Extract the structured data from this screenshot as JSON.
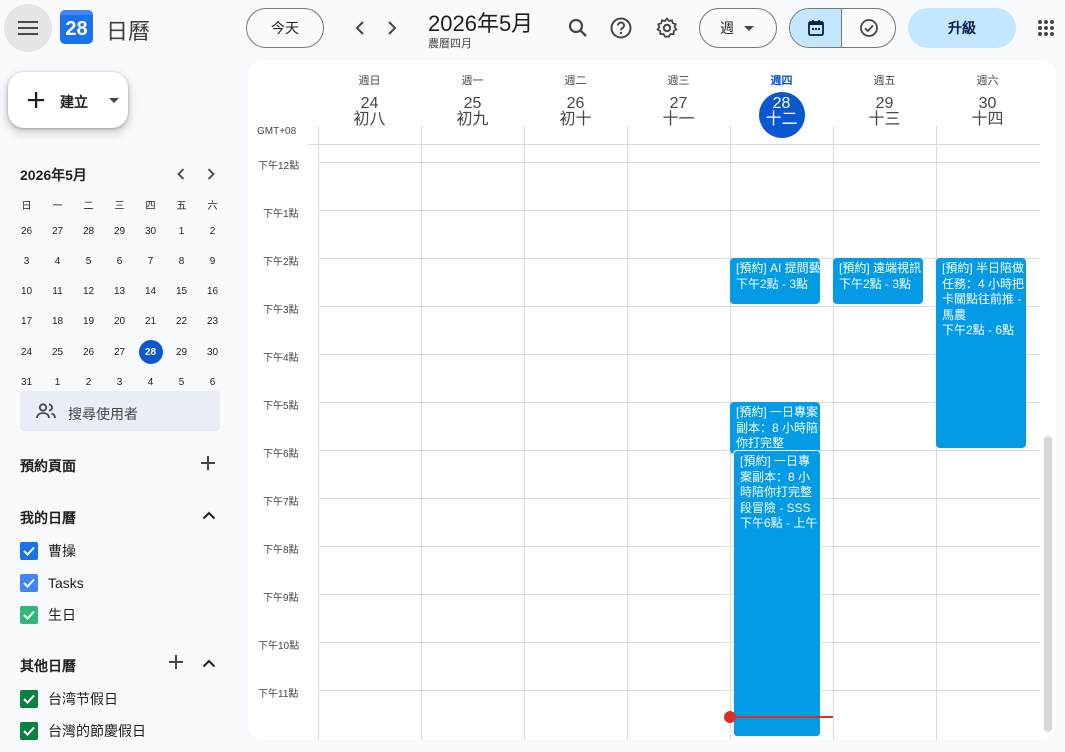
{
  "header": {
    "app_title": "日曆",
    "logo_day": "28",
    "today_label": "今天",
    "month_title": "2026年5月",
    "lunar_month": "農曆四月",
    "view_label": "週",
    "upgrade_label": "升級"
  },
  "sidebar": {
    "create_label": "建立",
    "mini_calendar": {
      "title": "2026年5月",
      "weekdays": [
        "日",
        "一",
        "二",
        "三",
        "四",
        "五",
        "六"
      ],
      "weeks": [
        [
          "26",
          "27",
          "28",
          "29",
          "30",
          "1",
          "2"
        ],
        [
          "3",
          "4",
          "5",
          "6",
          "7",
          "8",
          "9"
        ],
        [
          "10",
          "11",
          "12",
          "13",
          "14",
          "15",
          "16"
        ],
        [
          "17",
          "18",
          "19",
          "20",
          "21",
          "22",
          "23"
        ],
        [
          "24",
          "25",
          "26",
          "27",
          "28",
          "29",
          "30"
        ],
        [
          "31",
          "1",
          "2",
          "3",
          "4",
          "5",
          "6"
        ]
      ],
      "selected": "28"
    },
    "search_users_placeholder": "搜尋使用者",
    "booking_pages_label": "預約頁面",
    "my_calendars_label": "我的日曆",
    "my_calendars": [
      {
        "name": "曹操",
        "color": "#1a73e8"
      },
      {
        "name": "Tasks",
        "color": "#4285f4"
      },
      {
        "name": "生日",
        "color": "#33b679"
      }
    ],
    "other_calendars_label": "其他日曆",
    "other_calendars": [
      {
        "name": "台湾节假日",
        "color": "#0b8043"
      },
      {
        "name": "台灣的節慶假日",
        "color": "#0b8043"
      }
    ]
  },
  "calendar": {
    "timezone": "GMT+08",
    "days": [
      {
        "weekday": "週日",
        "date": "24",
        "lunar": "初八"
      },
      {
        "weekday": "週一",
        "date": "25",
        "lunar": "初九"
      },
      {
        "weekday": "週二",
        "date": "26",
        "lunar": "初十"
      },
      {
        "weekday": "週三",
        "date": "27",
        "lunar": "十一"
      },
      {
        "weekday": "週四",
        "date": "28",
        "lunar": "十二",
        "today": true
      },
      {
        "weekday": "週五",
        "date": "29",
        "lunar": "十三"
      },
      {
        "weekday": "週六",
        "date": "30",
        "lunar": "十四"
      }
    ],
    "hours": [
      "下午12點",
      "下午1點",
      "下午2點",
      "下午3點",
      "下午4點",
      "下午5點",
      "下午6點",
      "下午7點",
      "下午8點",
      "下午9點",
      "下午10點",
      "下午11點"
    ],
    "events": [
      {
        "title": "[預約] AI 提問藝術",
        "time": "下午2點 - 3點"
      },
      {
        "title": "[預約] 遠端視訊",
        "time": "下午2點 - 3點"
      },
      {
        "title": "[預約] 半日陪做任務：4 小時把卡關點往前推 - 馬農",
        "time": "下午2點 - 6點"
      },
      {
        "title": "[預約] 一日專案副本：8 小時陪你打完整",
        "time": ""
      },
      {
        "title": "[預約] 一日專案副本：8 小時陪你打完整段冒險 - SSS",
        "time": "下午6點 - 上午"
      }
    ],
    "accent": "#0b57d0",
    "event_color": "#039be5",
    "now_color": "#d93025"
  }
}
